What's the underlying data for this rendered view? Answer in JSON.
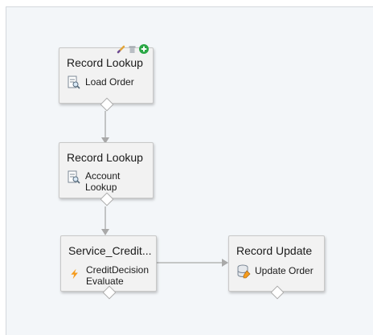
{
  "nodes": [
    {
      "title": "Record Lookup",
      "label_lines": [
        "Load Order"
      ],
      "icon": "record-lookup-icon"
    },
    {
      "title": "Record Lookup",
      "label_lines": [
        "Account",
        "Lookup"
      ],
      "icon": "record-lookup-icon"
    },
    {
      "title": "Service_Credit...",
      "label_lines": [
        "CreditDecision",
        "Evaluate"
      ],
      "icon": "lightning-bolt-icon"
    },
    {
      "title": "Record Update",
      "label_lines": [
        "Update Order"
      ],
      "icon": "record-update-icon"
    }
  ],
  "node_toolbar": [
    "edit-icon",
    "delete-icon",
    "add-icon"
  ],
  "colors": {
    "canvas_bg": "#f3f6f9",
    "node_bg": "#f2f2f2",
    "connector": "#a9a9a9",
    "add_green": "#2aa745",
    "bolt_orange": "#f59b1d"
  }
}
